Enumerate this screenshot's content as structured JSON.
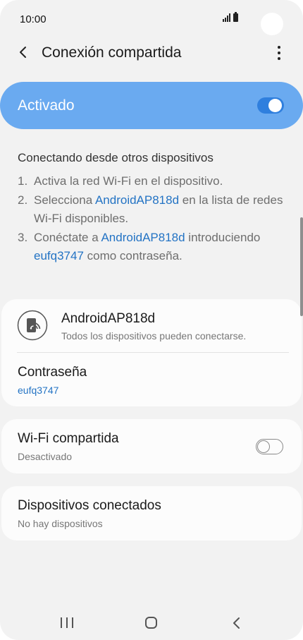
{
  "status_bar": {
    "time": "10:00"
  },
  "header": {
    "title": "Conexión compartida"
  },
  "master_switch": {
    "label": "Activado",
    "checked": true
  },
  "instructions": {
    "title": "Conectando desde otros dispositivos",
    "steps": [
      {
        "num": "1.",
        "text": "Activa la red Wi-Fi en el dispositivo."
      },
      {
        "num": "2.",
        "pre": "Selecciona ",
        "link": "AndroidAP818d",
        "post": " en la lista de redes Wi-Fi disponibles."
      },
      {
        "num": "3.",
        "pre": "Conéctate a ",
        "link": "AndroidAP818d",
        "mid": " introduciendo ",
        "link2": "eufq3747",
        "post": " como contraseña."
      }
    ]
  },
  "network": {
    "name": "AndroidAP818d",
    "subtitle": "Todos los dispositivos pueden conectarse.",
    "password_label": "Contraseña",
    "password_value": "eufq3747"
  },
  "wifi_sharing": {
    "title": "Wi-Fi compartida",
    "status": "Desactivado",
    "checked": false
  },
  "connected_devices": {
    "title": "Dispositivos conectados",
    "status": "No hay dispositivos"
  },
  "icons": {
    "back": "chevron-left",
    "more": "vertical-ellipsis",
    "hotspot": "hotspot-phone",
    "nav_recent": "recent-apps",
    "nav_home": "home",
    "nav_back": "back"
  },
  "colors": {
    "accent": "#2f7fde",
    "banner": "#6aaaf0",
    "link": "#2373c4",
    "background": "#f2f2f2",
    "card": "#fcfcfc"
  }
}
